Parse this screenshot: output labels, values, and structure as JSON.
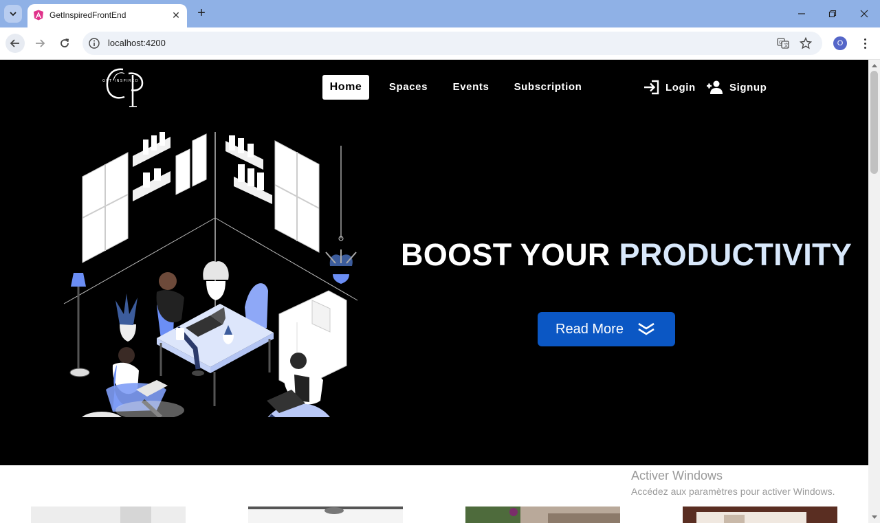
{
  "browser": {
    "tab_title": "GetInspiredFrontEnd",
    "url": "localhost:4200",
    "profile_initial": "O"
  },
  "site": {
    "nav": {
      "home": "Home",
      "spaces": "Spaces",
      "events": "Events",
      "subscription": "Subscription"
    },
    "auth": {
      "login": "Login",
      "signup": "Signup"
    },
    "logo_text": "GET INSPIRED",
    "hero": {
      "headline_part1": "BOOST YOUR ",
      "headline_part2": "PRODUCTIVITY",
      "cta": "Read More"
    }
  },
  "os_watermark": {
    "title": "Activer Windows",
    "subtitle": "Accédez aux paramètres pour activer Windows."
  },
  "colors": {
    "tabstrip": "#8fb1e6",
    "hero_bg": "#000000",
    "cta_bg": "#0b57c4",
    "accent_text": "#d8e8fb",
    "illustration_blue": "#6b8ef5"
  }
}
